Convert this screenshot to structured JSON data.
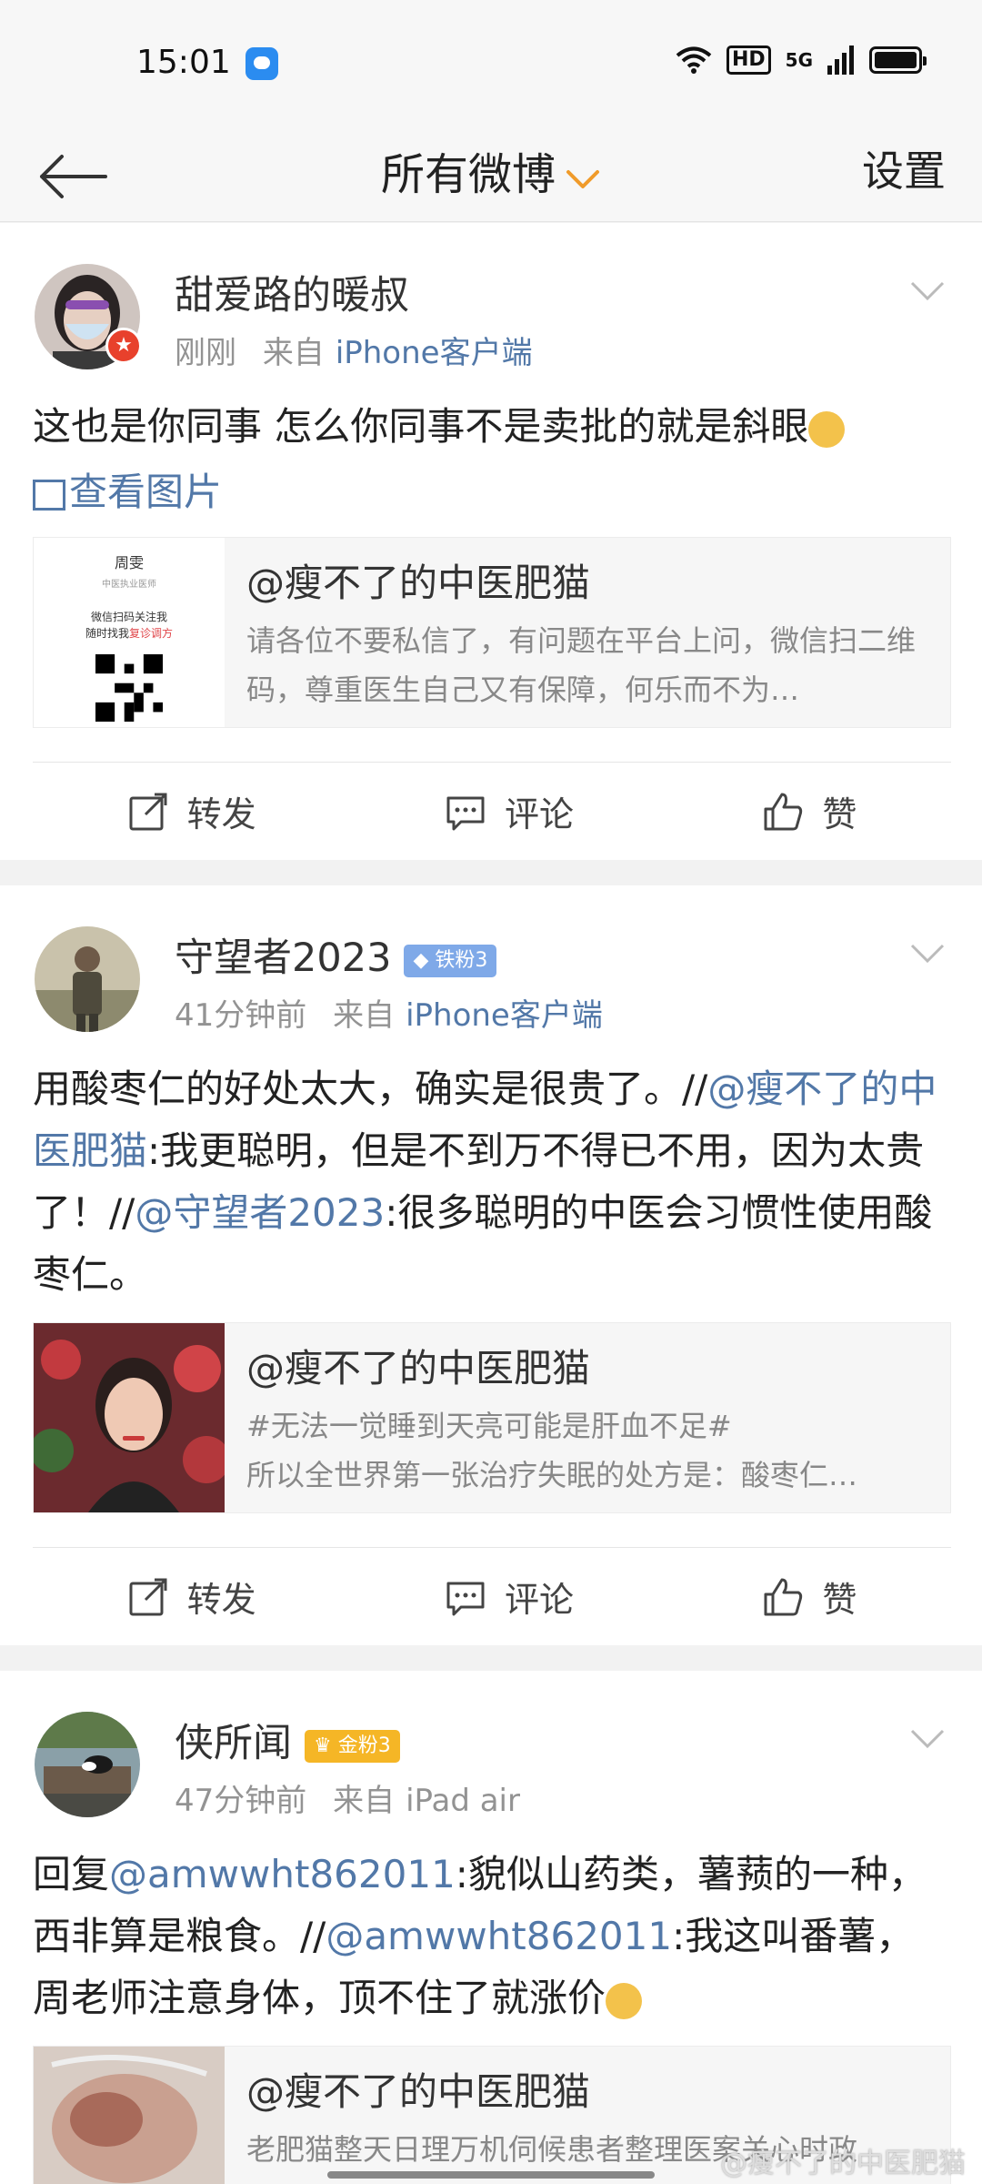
{
  "status_bar": {
    "time": "15:01",
    "hd": "HD",
    "network": "5G"
  },
  "nav": {
    "title": "所有微博",
    "settings_label": "设置"
  },
  "posts": [
    {
      "author": "甜爱路的暖叔",
      "time": "刚刚",
      "source_prefix": "来自",
      "source": "iPhone客户端",
      "text": "这也是你同事 怎么你同事不是卖批的就是斜眼",
      "view_pic": "查看图片",
      "quote": {
        "author": "@瘦不了的中医肥猫",
        "snippet": "请各位不要私信了，有问题在平台上问，微信扫二维码，尊重医生自己又有保障，何乐而不为…",
        "thumb_name": "周雯",
        "thumb_subtitle": "中医执业医师",
        "thumb_quote_1": "微信扫码关注我",
        "thumb_quote_2": "随时找我",
        "thumb_quote_highlight": "复诊调方"
      },
      "actions": {
        "repost": "转发",
        "comment": "评论",
        "like": "赞"
      }
    },
    {
      "author": "守望者2023",
      "badge": "铁粉3",
      "time": "41分钟前",
      "source_prefix": "来自",
      "source": "iPhone客户端",
      "text_parts": [
        "用酸枣仁的好处太大，确实是很贵了。//",
        "@瘦不了的中医肥猫",
        ":我更聪明，但是不到万不得已不用，因为太贵了！//",
        "@守望者2023",
        ":很多聪明的中医会习惯性使用酸枣仁。"
      ],
      "quote": {
        "author": "@瘦不了的中医肥猫",
        "snippet_1": "#无法一觉睡到天亮可能是肝血不足#",
        "snippet_2": "所以全世界第一张治疗失眠的处方是：酸枣仁…"
      },
      "actions": {
        "repost": "转发",
        "comment": "评论",
        "like": "赞"
      }
    },
    {
      "author": "侠所闻",
      "badge": "金粉3",
      "time": "47分钟前",
      "source_prefix": "来自",
      "source": "iPad air",
      "text_parts": [
        "回复",
        "@amwwht862011",
        ":貌似山药类，薯蓣的一种，西非算是粮食。//",
        "@amwwht862011",
        ":我这叫番薯，周老师注意身体，顶不住了就涨价"
      ],
      "quote": {
        "author": "@瘦不了的中医肥猫",
        "snippet": "老肥猫整天日理万机伺候患者整理医案关心时政"
      }
    }
  ],
  "watermark": "@瘦不了的中医肥猫",
  "colors": {
    "link": "#5278a8",
    "accent": "#f09b2a",
    "badge_blue": "#7fa9e8",
    "badge_gold": "#f5b626"
  }
}
